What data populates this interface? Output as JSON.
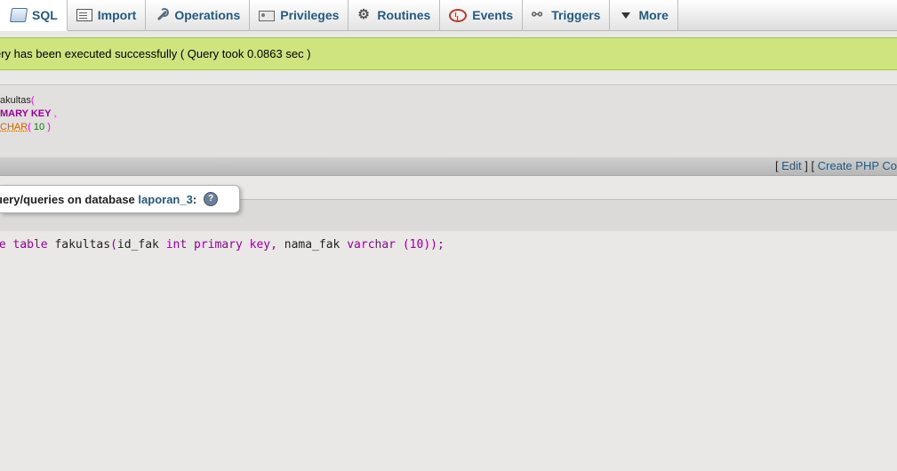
{
  "tabs": [
    {
      "label": "SQL",
      "icon": "sql-icon",
      "active": true
    },
    {
      "label": "Import",
      "icon": "import-icon"
    },
    {
      "label": "Operations",
      "icon": "wrench-icon"
    },
    {
      "label": "Privileges",
      "icon": "privileges-icon"
    },
    {
      "label": "Routines",
      "icon": "routines-icon"
    },
    {
      "label": "Events",
      "icon": "clock-icon"
    },
    {
      "label": "Triggers",
      "icon": "triggers-icon"
    },
    {
      "label": "More",
      "icon": "triangle-down-icon"
    }
  ],
  "message": {
    "text": "ery has been executed successfully ( Query took 0.0863 sec )",
    "color": "#cfe37e"
  },
  "sql": {
    "l1_name": "akultas",
    "l1_paren": "(",
    "l2_kw": "MARY KEY",
    "l2_comma": " ,",
    "l3_type": "CHAR",
    "l3_open": "( ",
    "l3_num": "10",
    "l3_close": " )"
  },
  "links": {
    "open1": "[ ",
    "edit": "Edit",
    "mid": " ] [ ",
    "create_php": "Create PHP Co"
  },
  "query_box": {
    "legend_prefix": "uery/queries on database ",
    "database": "laporan_3",
    "legend_suffix": ":",
    "help": "?"
  },
  "editor": {
    "p1": "te ",
    "p2": "table",
    "p3": " fakultas",
    "p4": "(",
    "p5": "id_fak ",
    "p6": "int",
    "p7": " ",
    "p8": "primary key,",
    "p9": " nama_fak ",
    "p10": "varchar",
    "p11": " (",
    "p12": "10",
    "p13": "));"
  }
}
